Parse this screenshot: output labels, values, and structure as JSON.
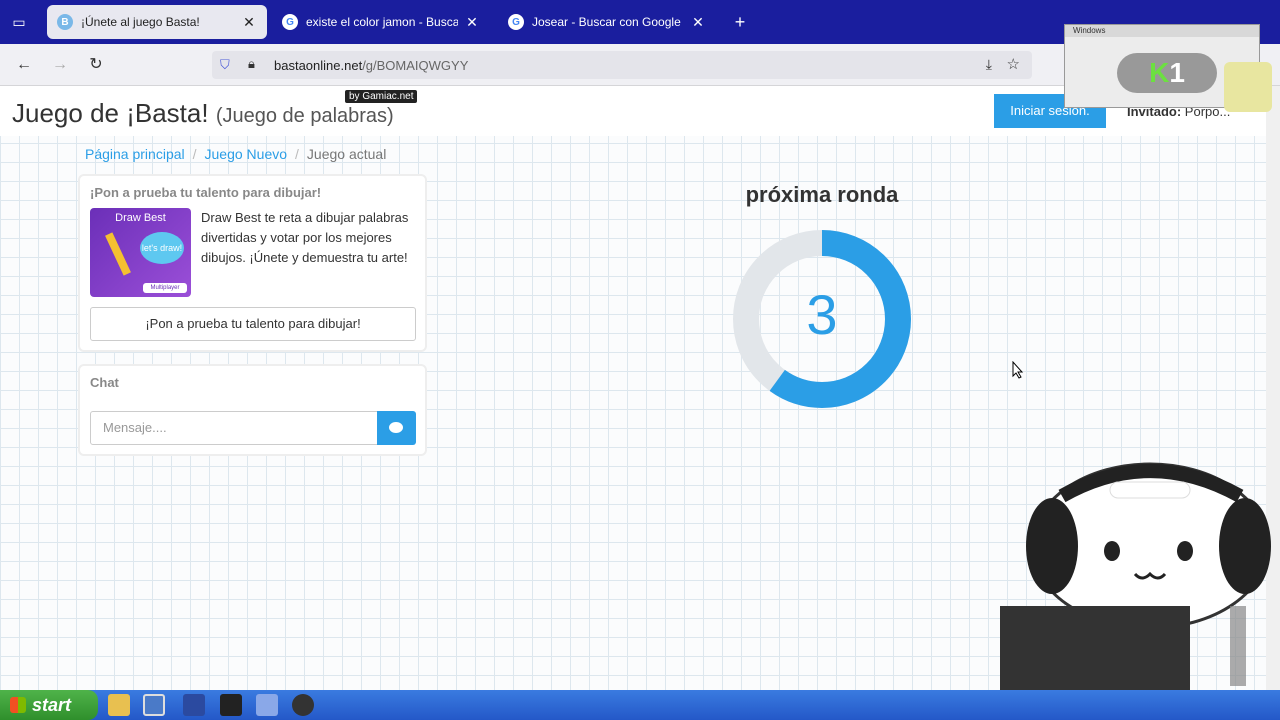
{
  "browser": {
    "tabs": [
      {
        "title": "¡Únete al juego Basta!",
        "active": true,
        "favicon": "basta-icon"
      },
      {
        "title": "existe el color jamon - Buscar con Google",
        "active": false,
        "favicon": "google-icon"
      },
      {
        "title": "Josear - Buscar con Google",
        "active": false,
        "favicon": "google-icon"
      }
    ],
    "new_tab": "+",
    "url_host": "bastaonline.net",
    "url_path": "/g/BOMAIQWGYY"
  },
  "header": {
    "title": "Juego de ¡Basta!",
    "subtitle": "(Juego de palabras)",
    "by_tag": "by Gamiac.net",
    "login_label": "Iniciar sesión.",
    "guest_label": "Invitado:",
    "guest_name": "Porpo..."
  },
  "breadcrumb": {
    "home": "Página principal",
    "new_game": "Juego Nuevo",
    "current": "Juego actual"
  },
  "promo": {
    "title": "¡Pon a prueba tu talento para dibujar!",
    "image_name": "Draw Best",
    "image_bubble": "let's draw!",
    "image_badge": "Multiplayer",
    "text": "Draw Best te reta a dibujar palabras divertidas y votar por los mejores dibujos. ¡Únete y demuestra tu arte!",
    "button_label": "¡Pon a prueba tu talento para dibujar!"
  },
  "chat": {
    "title": "Chat",
    "placeholder": "Mensaje...."
  },
  "round": {
    "title": "próxima ronda",
    "countdown": "3",
    "progress_fraction": 0.6
  },
  "overlay": {
    "window_title": "Windows",
    "logo_k": "K",
    "logo_num": "1"
  },
  "taskbar": {
    "start_label": "start"
  },
  "colors": {
    "accent": "#2b9ee6",
    "tabstrip": "#1a1e9e",
    "taskbar": "#2458c8"
  }
}
